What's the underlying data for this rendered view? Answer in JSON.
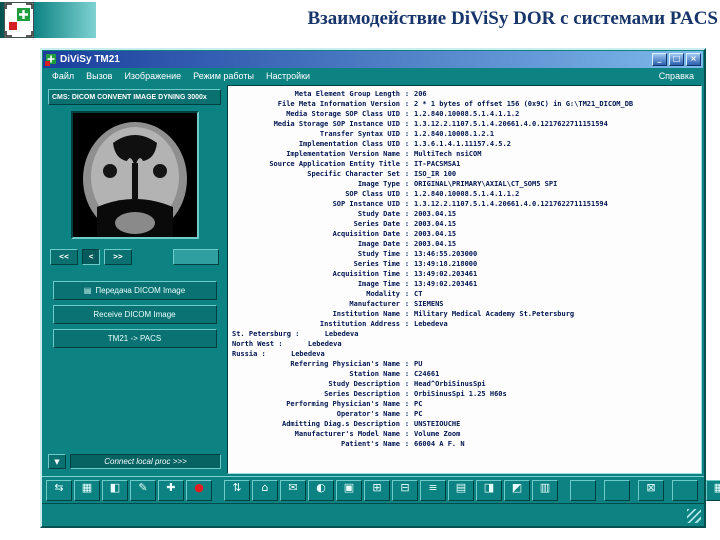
{
  "slide": {
    "title": "Взаимодействие DiViSy DOR с системами PACS"
  },
  "window": {
    "title": "DiViSy TM21",
    "controls": [
      {
        "glyph": "_",
        "name": "minimize"
      },
      {
        "glyph": "□",
        "name": "maximize"
      },
      {
        "glyph": "×",
        "name": "close"
      }
    ],
    "menu": [
      "Файл",
      "Вызов",
      "Изображение",
      "Режим работы",
      "Настройки"
    ],
    "help_menu": "Справка"
  },
  "left_panel": {
    "series_selector": "CMS: DICOM CONVENT IMAGE DYNING 3000x",
    "nav_buttons": [
      "<<",
      "<",
      ">>"
    ],
    "action_icon": "▤",
    "action_buttons": [
      "Передача DICOM Image",
      "Receive DICOM Image",
      "TM21 -> PACS"
    ],
    "mini_button": "▼",
    "bottom_button": "Connect local proc >>>"
  },
  "dicom": {
    "fields": [
      {
        "name": "Meta Element Group Length",
        "value": "206"
      },
      {
        "name": "File Meta Information Version",
        "value": "2 * 1 bytes of offset 156 (0x9C) in G:\\TM21_DICOM_DB"
      },
      {
        "name": "Media Storage SOP Class UID",
        "value": "1.2.840.10008.5.1.4.1.1.2"
      },
      {
        "name": "Media Storage SOP Instance UID",
        "value": "1.3.12.2.1107.5.1.4.20661.4.0.1217622711151594"
      },
      {
        "name": "Transfer Syntax UID",
        "value": "1.2.840.10008.1.2.1"
      },
      {
        "name": "Implementation Class UID",
        "value": "1.3.6.1.4.1.11157.4.5.2"
      },
      {
        "name": "Implementation Version Name",
        "value": "MultiTech nsiCOM"
      },
      {
        "name": "Source Application Entity Title",
        "value": "IT-PACSMSA1"
      },
      {
        "name": "Specific Character Set",
        "value": "ISO_IR 100"
      },
      {
        "name": "Image Type",
        "value": "ORIGINAL\\PRIMARY\\AXIAL\\CT_SOM5 SPI"
      },
      {
        "name": "SOP Class UID",
        "value": "1.2.840.10008.5.1.4.1.1.2"
      },
      {
        "name": "SOP Instance UID",
        "value": "1.3.12.2.1107.5.1.4.20661.4.0.1217622711151594"
      },
      {
        "name": "Study Date",
        "value": "2003.04.15"
      },
      {
        "name": "Series Date",
        "value": "2003.04.15"
      },
      {
        "name": "Acquisition Date",
        "value": "2003.04.15"
      },
      {
        "name": "Image Date",
        "value": "2003.04.15"
      },
      {
        "name": "Study Time",
        "value": "13:46:55.203000"
      },
      {
        "name": "Series Time",
        "value": "13:49:18.218000"
      },
      {
        "name": "Acquisition Time",
        "value": "13:49:02.203461"
      },
      {
        "name": "Image Time",
        "value": "13:49:02.203461"
      },
      {
        "name": "Modality",
        "value": "CT"
      },
      {
        "name": "Manufacturer",
        "value": "SIEMENS"
      },
      {
        "name": "Institution Name",
        "value": "Military Medical Academy St.Petersburg"
      },
      {
        "name": "Institution Address",
        "value": "Lebedeva"
      },
      {
        "text": "St. Petersburg :      Lebedeva"
      },
      {
        "text": "North West :      Lebedeva"
      },
      {
        "text": "Russia :      Lebedeva"
      },
      {
        "name": "Referring Physician's Name",
        "value": "PU"
      },
      {
        "name": "Station Name",
        "value": "C24661"
      },
      {
        "name": "Study Description",
        "value": "Head^OrbiSinusSpi"
      },
      {
        "name": "Series Description",
        "value": "OrbiSinusSpi 1.25 H60s"
      },
      {
        "name": "Performing Physician's Name",
        "value": "PC"
      },
      {
        "name": "Operator's Name",
        "value": "PC"
      },
      {
        "name": "Admitting Diag.s Description",
        "value": "UNSTEIOUCHE"
      },
      {
        "name": "Manufacturer's Model Name",
        "value": "Volume Zoom"
      },
      {
        "name": "Patient's Name",
        "value": "66004 A F. N"
      }
    ]
  },
  "toolbar": {
    "groups": [
      {
        "buttons": [
          {
            "glyph": "⇆",
            "name": "transfer"
          },
          {
            "glyph": "▦",
            "name": "tile-grid"
          },
          {
            "glyph": "◧",
            "name": "split-view"
          },
          {
            "glyph": "✎",
            "name": "annotate"
          },
          {
            "glyph": "✚",
            "name": "crosshair"
          },
          {
            "glyph": "●",
            "name": "record"
          }
        ]
      },
      {
        "buttons": [
          {
            "glyph": "⇅",
            "name": "sort"
          },
          {
            "glyph": "⌂",
            "name": "home"
          },
          {
            "glyph": "✉",
            "name": "send"
          },
          {
            "glyph": "◐",
            "name": "contrast"
          },
          {
            "glyph": "▣",
            "name": "select-frame"
          },
          {
            "glyph": "⊞",
            "name": "zoom-in"
          },
          {
            "glyph": "⊟",
            "name": "zoom-out"
          },
          {
            "glyph": "≡",
            "name": "list"
          },
          {
            "glyph": "▤",
            "name": "rows"
          },
          {
            "glyph": "◨",
            "name": "pane-right"
          },
          {
            "glyph": "◩",
            "name": "pane-corner"
          },
          {
            "glyph": "▥",
            "name": "columns"
          }
        ]
      },
      {
        "spread": true,
        "buttons": [
          {
            "glyph": "",
            "name": "blank-1"
          },
          {
            "glyph": "",
            "name": "blank-2"
          },
          {
            "glyph": "⊠",
            "name": "close-study"
          },
          {
            "glyph": "",
            "name": "blank-3"
          },
          {
            "glyph": "▦",
            "name": "layout-grid"
          }
        ]
      }
    ]
  },
  "colors": {
    "chrome-teal": "#0d8282",
    "chrome-dark": "#05504e",
    "titlebar-start": "#1b3f9e",
    "titlebar-end": "#7db9ea",
    "slide-title": "#17356b",
    "dicom-text": "#001550",
    "record-red": "#e02020"
  }
}
